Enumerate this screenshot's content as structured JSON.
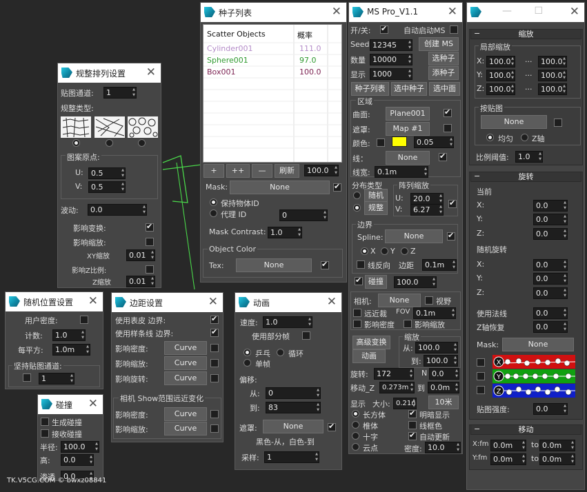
{
  "watermark": "TK.V5CG.COM © bwxz08841",
  "w1": {
    "title": "规整排列设置",
    "map_channel_label": "贴图通道:",
    "map_channel": "1",
    "type_label": "规整类型:",
    "pattern_origin": "图案原点:",
    "u_label": "U:",
    "u": "0.5",
    "v_label": "V:",
    "v": "0.5",
    "wave_label": "波动:",
    "wave": "0.0",
    "affect_transform": "影响变换:",
    "affect_scale": "影响缩放:",
    "xy_scale": "XY缩放",
    "xy_val": "0.01",
    "affect_z": "影响Z比例:",
    "z_scale": "Z缩放",
    "z_val": "0.01"
  },
  "w2": {
    "title": "随机位置设置",
    "user_density": "用户密度:",
    "count_label": "计数:",
    "count": "1.0",
    "per_sq_label": "每平方:",
    "per_sq": "1.0m",
    "stick_map": "坚持贴图通道:",
    "stick_val": "1"
  },
  "w3": {
    "title": "碰撞",
    "gen_collision": "生成碰撞",
    "recv_collision": "接收碰撞",
    "radius_label": "半径:",
    "radius": "100.0",
    "height_label": "高:",
    "height": "0.0",
    "infiltrate": "渗透",
    "infiltrate_val": "0.0"
  },
  "w4": {
    "title": "边距设置",
    "use_skin": "使用表皮 边界:",
    "use_spline": "使用样条线 边界:",
    "aff_density": "影响密度:",
    "aff_scale": "影响缩放:",
    "aff_rotate": "影响旋转:",
    "curve": "Curve",
    "camera_group": "相机 Show范围远近变化",
    "cam_density": "影响密度:",
    "cam_scale": "影响缩放:"
  },
  "w5": {
    "title": "动画",
    "speed_label": "速度:",
    "speed": "1.0",
    "use_partial": "使用部分帧",
    "pingpong": "乒乓",
    "loop": "循环",
    "single": "单帧",
    "offset": "偏移:",
    "from_label": "从:",
    "from": "0",
    "to_label": "到:",
    "to": "83",
    "mask_label": "遮罩:",
    "mask": "None",
    "bw_note": "黑色-从，白色-到",
    "sample_label": "采样:",
    "sample": "1"
  },
  "w6": {
    "title": "种子列表",
    "col_objects": "Scatter Objects",
    "col_prob": "概率",
    "rows": [
      {
        "name": "Cylinder001",
        "prob": "111.0",
        "color": "#b48cc8"
      },
      {
        "name": "Sphere001",
        "prob": "97.0",
        "color": "#2f9a2f"
      },
      {
        "name": "Box001",
        "prob": "100.0",
        "color": "#7a1f4f"
      }
    ],
    "add": "+",
    "add_multi": "++",
    "remove": "—",
    "refresh": "刷新",
    "refresh_val": "100.0",
    "mask_label": "Mask:",
    "mask": "None",
    "keep_id": "保持物体ID",
    "proxy_id": "代理 ID",
    "proxy_val": "0",
    "mask_contrast_label": "Mask Contrast:",
    "mask_contrast": "1.0",
    "object_color": "Object Color",
    "tex_label": "Tex:",
    "tex": "None"
  },
  "w7": {
    "title": "MS Pro_V1.1",
    "onoff": "开/关:",
    "auto_ms": "自动启动MS",
    "seed_label": "Seed",
    "seed": "12345",
    "create_ms": "创建 MS",
    "count_label": "数量",
    "count": "10000",
    "pick_seed": "选种子",
    "display_label": "显示",
    "display": "1000",
    "add_seed": "添种子",
    "seed_list": "种子列表",
    "sel_seed": "选中种子",
    "sel_face": "选中面",
    "region": "区域",
    "surface_label": "曲面:",
    "surface": "Plane001",
    "mask_label": "遮罩:",
    "mask": "Map #1",
    "color_label": "颜色:",
    "color_val": "0.05",
    "swatch": "#ffff00",
    "line_label": "线：",
    "line": "None",
    "line_width_label": "线宽:",
    "line_width": "0.1m",
    "dist_type": "分布类型",
    "random": "随机",
    "regular": "规整",
    "array_scale": "阵列缩放",
    "u_label": "U:",
    "u": "20.0",
    "v_label": "V:",
    "v": "6.27",
    "border": "边界",
    "spline_label": "Spline:",
    "spline": "None",
    "x": "X",
    "y": "Y",
    "z": "Z",
    "line_reverse": "线反向",
    "margin": "边距",
    "margin_val": "0.1m",
    "collision": "碰撞",
    "collision_val": "100.0",
    "camera": "相机:",
    "camera_val": "None",
    "view": "视野",
    "near_far": "远近裁",
    "fov": "FOV",
    "fov_val": "0.1m",
    "aff_density": "影响密度",
    "aff_scale": "影响缩放",
    "adv_transform": "高级变换",
    "anim": "动画",
    "scale": "缩放",
    "from": "从:",
    "from_val": "100.0",
    "to": "到:",
    "to_val": "100.0",
    "rotate_label": "旋转:",
    "rotate": "172",
    "n_label": "N",
    "n_val": "0.0",
    "move_label": "移动_Z",
    "move": "0.273m",
    "move_to": "到",
    "move_to_val": "0.0m",
    "disp_label": "显示",
    "size_label": "大小:",
    "size": "0.21n",
    "size_btn": "10米",
    "box": "长方体",
    "bright": "明暗显示",
    "cone": "椎体",
    "wire": "线框色",
    "cross": "十字",
    "auto_update": "自动更新",
    "cloud": "云点",
    "density_label": "密度:",
    "density": "10.0"
  },
  "w8": {
    "title": "",
    "scale": "缩放",
    "local_scale": "局部缩放",
    "x": "X:",
    "y": "Y:",
    "z": "Z:",
    "lx1": "100.0",
    "lx2": "100.0",
    "ly1": "100.0",
    "ly2": "100.0",
    "lz1": "100.0",
    "lz2": "100.0",
    "dots": "...",
    "by_map": "按贴图",
    "map_btn": "None",
    "uniform": "均匀",
    "z_axis": "Z轴",
    "ratio_label": "比例阈值:",
    "ratio": "1.0",
    "rotate": "旋转",
    "current": "当前",
    "cx": "0.0",
    "cy": "0.0",
    "cz": "0.0",
    "rand_rot": "随机旋转",
    "rx": "0.0",
    "ry": "0.0",
    "rz": "0.0",
    "use_normal": "使用法线",
    "normal_val": "0.0",
    "z_restore": "Z轴恢复",
    "z_restore_val": "0.0",
    "mask_label": "Mask:",
    "mask": "None",
    "tex_strength": "贴图强度:",
    "tex_strength_val": "0.0",
    "move": "移动",
    "xfm": "X:fm",
    "yfm": "Y:fm",
    "mx1": "0.0m",
    "mx2": "0.0m",
    "my1": "0.0m",
    "my2": "0.0m",
    "to": "to"
  }
}
